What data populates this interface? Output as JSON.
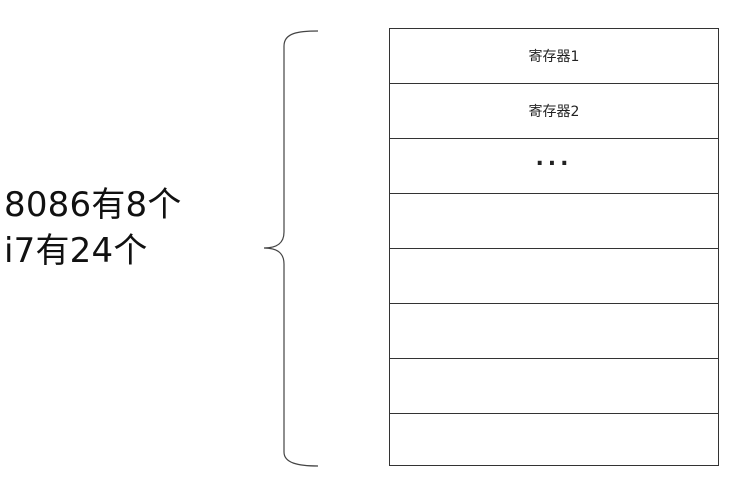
{
  "count_label": {
    "line1": "8086有8个",
    "line2": "i7有24个"
  },
  "registers": {
    "rows": [
      {
        "label": "寄存器1"
      },
      {
        "label": "寄存器2"
      },
      {
        "label": "..."
      },
      {
        "label": ""
      },
      {
        "label": ""
      },
      {
        "label": ""
      },
      {
        "label": ""
      },
      {
        "label": ""
      }
    ]
  },
  "colors": {
    "stroke": "#333333",
    "text": "#111111",
    "background": "#ffffff"
  }
}
